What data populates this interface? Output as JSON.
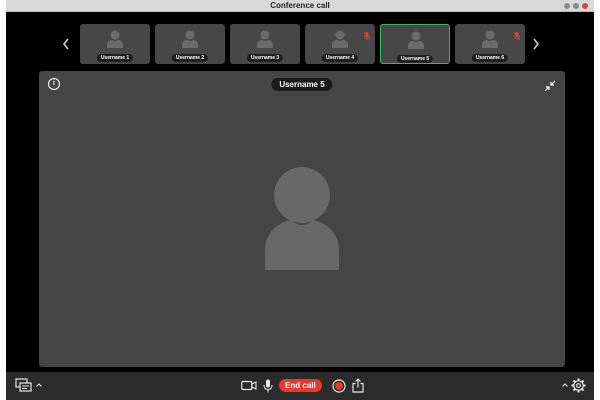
{
  "window": {
    "title": "Conference call"
  },
  "participants": [
    {
      "name": "Username 1",
      "muted": false,
      "active": false
    },
    {
      "name": "Username 2",
      "muted": false,
      "active": false
    },
    {
      "name": "Username 3",
      "muted": false,
      "active": false
    },
    {
      "name": "Username 4",
      "muted": true,
      "active": false
    },
    {
      "name": "Username 5",
      "muted": false,
      "active": true
    },
    {
      "name": "Username 6",
      "muted": true,
      "active": false
    }
  ],
  "main_view": {
    "speaker": "Username 5",
    "info_glyph": "i"
  },
  "toolbar": {
    "end_call_label": "End call"
  },
  "icons": {
    "prev": "chevron-left-icon",
    "next": "chevron-right-icon",
    "info": "info-icon",
    "minimize": "minimize-icon",
    "chat": "chat-icon",
    "camera": "video-camera-icon",
    "mic": "microphone-icon",
    "record": "record-icon",
    "share": "share-icon",
    "settings": "gear-icon"
  },
  "colors": {
    "active_border": "#33c05a",
    "end_call": "#e8372c",
    "muted": "#e0443e",
    "tile": "#474747",
    "stage": "#454545"
  }
}
